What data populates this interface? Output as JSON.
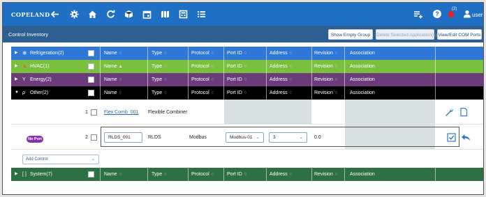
{
  "brand": "COPELAND",
  "colors": {
    "topbar": "#1f6fc5",
    "subbar": "#2e5f93",
    "refrigeration": "#2f77d6",
    "hvac": "#7bbf3e",
    "energy": "#6c3c7a",
    "other": "#000000",
    "system": "#2e6f43",
    "no_port": "#8b2fb0"
  },
  "toolbar_icons": [
    "back-arrow-icon",
    "settings-gear-icon",
    "home-icon",
    "refresh-icon",
    "cube-icon",
    "calendar-icon",
    "map-icon",
    "calculator-icon",
    "list-icon",
    "add-list-icon",
    "help-icon",
    "alarm-bell-icon",
    "user-icon"
  ],
  "alarm_count": "(2)",
  "user_label": "user",
  "page_title": "Control Inventory",
  "buttons": {
    "show_empty_group": "Show Empty Group",
    "delete_selected": "Delete Selected Application(s)",
    "view_edit_com_ports": "View/Edit COM Ports"
  },
  "columns": {
    "name": "Name",
    "type": "Type",
    "protocol": "Protocol",
    "port_id": "Port ID",
    "address": "Address",
    "revision": "Revision",
    "association": "Association",
    "sort_indicator": "♢"
  },
  "groups": {
    "refrigeration": "Refrigeration(2)",
    "hvac": "HVAC(1)",
    "energy": "Energy(2)",
    "other": "Other(2)",
    "system": "System(7)"
  },
  "rows": [
    {
      "index": "1",
      "name": "Flex Comb_001",
      "type": "Flexible Combiner"
    },
    {
      "index": "2",
      "name": "RLDS_001",
      "type": "RLDS",
      "protocol": "Modbus",
      "port_id": "Modbus-01",
      "address": "3",
      "revision": "0.0"
    }
  ],
  "no_port_badge": "No Port",
  "add_control": "Add Control"
}
